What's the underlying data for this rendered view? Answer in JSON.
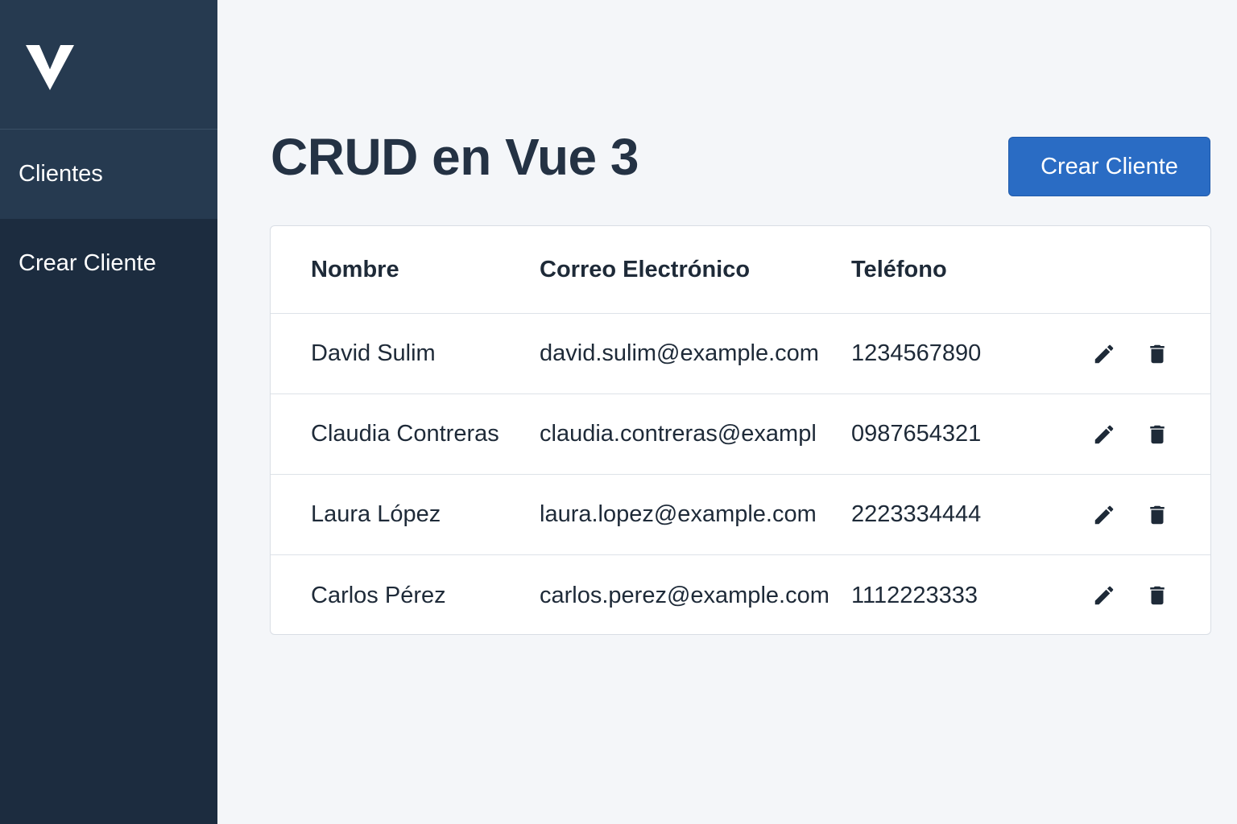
{
  "sidebar": {
    "logo_icon": "vue-logo-icon",
    "items": [
      {
        "label": "Clientes",
        "active": true
      },
      {
        "label": "Crear Cliente",
        "active": false
      }
    ]
  },
  "main": {
    "title": "CRUD en Vue 3",
    "create_button_label": "Crear Cliente"
  },
  "table": {
    "headers": [
      "Nombre",
      "Correo Electrónico",
      "Teléfono"
    ],
    "rows": [
      {
        "name": "David Sulim",
        "email": "david.sulim@example.com",
        "phone": "1234567890"
      },
      {
        "name": "Claudia Contreras",
        "email": "claudia.contreras@exampl",
        "phone": "0987654321"
      },
      {
        "name": "Laura López",
        "email": "laura.lopez@example.com",
        "phone": "2223334444"
      },
      {
        "name": "Carlos Pérez",
        "email": "carlos.perez@example.com",
        "phone": "1112223333"
      }
    ],
    "action_icons": [
      "pencil-icon",
      "trash-icon"
    ]
  },
  "colors": {
    "sidebar_bg": "#1c2c3f",
    "sidebar_active_bg": "#263a50",
    "accent": "#2a6cc4",
    "page_bg": "#f4f6f9"
  }
}
